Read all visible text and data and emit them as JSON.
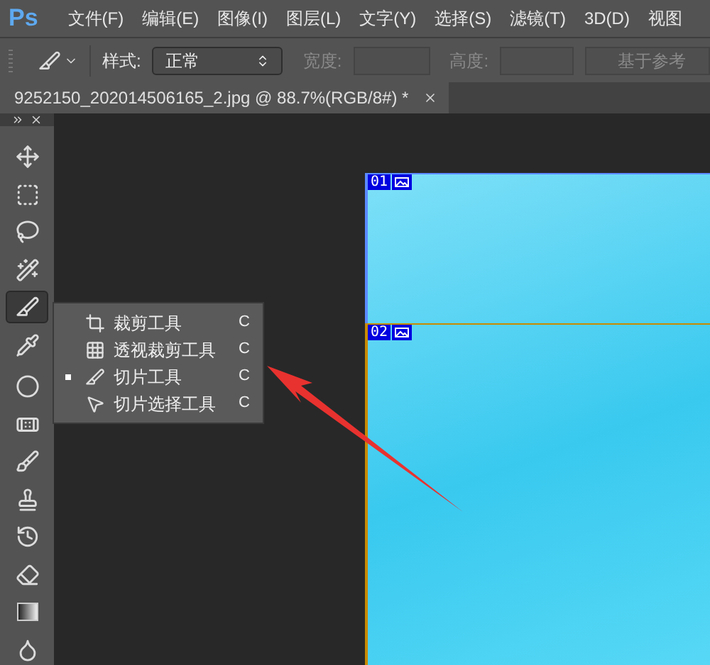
{
  "app_logo": "Ps",
  "menu": [
    "文件(F)",
    "编辑(E)",
    "图像(I)",
    "图层(L)",
    "文字(Y)",
    "选择(S)",
    "滤镜(T)",
    "3D(D)",
    "视图"
  ],
  "options_bar": {
    "style_label": "样式:",
    "style_value": "正常",
    "width_label": "宽度:",
    "width_disabled": true,
    "height_label": "高度:",
    "reference_button": "基于参考"
  },
  "document_tab": {
    "title": "9252150_202014506165_2.jpg @ 88.7%(RGB/8#) *"
  },
  "tools": [
    {
      "selected": false
    },
    {
      "selected": false
    },
    {
      "selected": false
    },
    {
      "selected": false
    },
    {
      "selected": true
    },
    {
      "selected": false
    },
    {
      "selected": false
    },
    {
      "selected": false
    },
    {
      "selected": false
    },
    {
      "selected": false
    },
    {
      "selected": false
    },
    {
      "selected": false
    },
    {
      "selected": false
    },
    {
      "selected": false
    }
  ],
  "flyout": [
    {
      "label": "裁剪工具",
      "shortcut": "C",
      "selected": false
    },
    {
      "label": "透视裁剪工具",
      "shortcut": "C",
      "selected": false
    },
    {
      "label": "切片工具",
      "shortcut": "C",
      "selected": true
    },
    {
      "label": "切片选择工具",
      "shortcut": "C",
      "selected": false
    }
  ],
  "slices": [
    {
      "number": "01"
    },
    {
      "number": "02"
    }
  ]
}
